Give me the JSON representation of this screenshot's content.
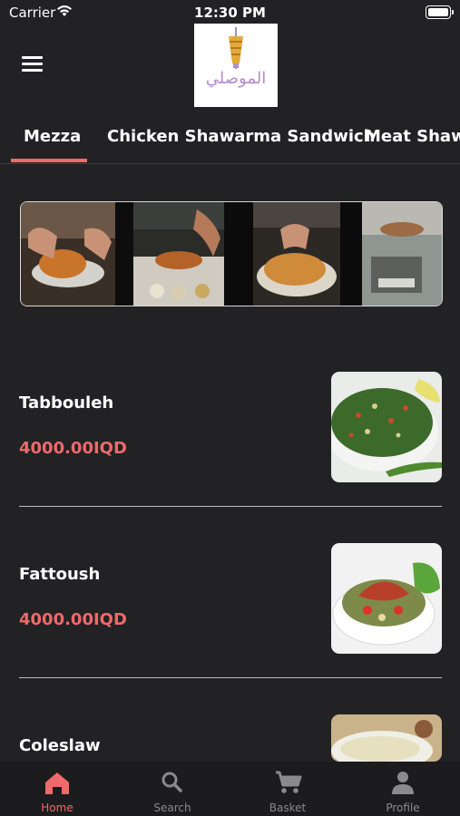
{
  "status_bar": {
    "carrier": "Carrier",
    "time": "12:30 PM"
  },
  "header": {
    "logo_text": "الموصلي"
  },
  "colors": {
    "accent": "#ef6a6a",
    "background": "#222225",
    "tabbar": "#1c1c1e"
  },
  "tabs": [
    {
      "label": "Mezza",
      "active": true
    },
    {
      "label": "Chicken Shawarma Sandwich",
      "active": false
    },
    {
      "label": "Meat Shawa",
      "active": false
    }
  ],
  "menu_items": [
    {
      "name": "Tabbouleh",
      "price": "4000.00IQD"
    },
    {
      "name": "Fattoush",
      "price": "4000.00IQD"
    },
    {
      "name": "Coleslaw",
      "price": ""
    }
  ],
  "tab_bar": [
    {
      "label": "Home",
      "icon": "home-icon",
      "active": true
    },
    {
      "label": "Search",
      "icon": "search-icon",
      "active": false
    },
    {
      "label": "Basket",
      "icon": "cart-icon",
      "active": false
    },
    {
      "label": "Profile",
      "icon": "person-icon",
      "active": false
    }
  ]
}
